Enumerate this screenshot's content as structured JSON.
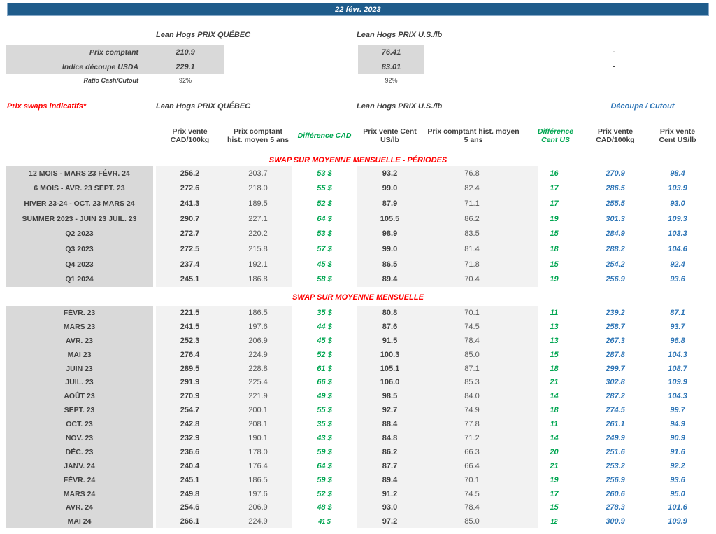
{
  "banner": {
    "date": "22 févr. 2023"
  },
  "summary": {
    "header_quebec": "Lean Hogs PRIX QUÉBEC",
    "header_us": "Lean Hogs PRIX U.S./lb",
    "rows": [
      {
        "label": "Prix comptant",
        "quebec": "210.9",
        "us": "76.41",
        "right": "-"
      },
      {
        "label": "Indice découpe USDA",
        "quebec": "229.1",
        "us": "83.01",
        "right": "-"
      },
      {
        "label": "Ratio Cash/Cutout",
        "quebec": "92%",
        "us": "92%",
        "right": ""
      }
    ]
  },
  "table": {
    "left_title": "Prix swaps indicatifs*",
    "group_quebec": "Lean Hogs PRIX QUÉBEC",
    "group_us": "Lean Hogs PRIX U.S./lb",
    "group_cutout": "Découpe / Cutout",
    "subheaders": [
      "Prix vente CAD/100kg",
      "Prix comptant hist. moyen 5 ans",
      "Différence CAD",
      "Prix vente Cent US/lb",
      "Prix comptant hist. moyen 5 ans",
      "Différence Cent US",
      "Prix vente CAD/100kg",
      "Prix vente Cent US/lb"
    ],
    "sections": [
      {
        "title": "SWAP SUR MOYENNE MENSUELLE - PÉRIODES",
        "rows": [
          [
            "12 MOIS - MARS 23 FÉVR. 24",
            "256.2",
            "203.7",
            "53 $",
            "93.2",
            "76.8",
            "16",
            "270.9",
            "98.4"
          ],
          [
            "6 MOIS - AVR. 23 SEPT. 23",
            "272.6",
            "218.0",
            "55 $",
            "99.0",
            "82.4",
            "17",
            "286.5",
            "103.9"
          ],
          [
            "HIVER 23-24 -  OCT. 23 MARS 24",
            "241.3",
            "189.5",
            "52 $",
            "87.9",
            "71.1",
            "17",
            "255.5",
            "93.0"
          ],
          [
            "SUMMER 2023 - JUIN 23 JUIL. 23",
            "290.7",
            "227.1",
            "64 $",
            "105.5",
            "86.2",
            "19",
            "301.3",
            "109.3"
          ],
          [
            "Q2 2023",
            "272.7",
            "220.2",
            "53 $",
            "98.9",
            "83.5",
            "15",
            "284.9",
            "103.3"
          ],
          [
            "Q3 2023",
            "272.5",
            "215.8",
            "57 $",
            "99.0",
            "81.4",
            "18",
            "288.2",
            "104.6"
          ],
          [
            "Q4 2023",
            "237.4",
            "192.1",
            "45 $",
            "86.5",
            "71.8",
            "15",
            "254.2",
            "92.4"
          ],
          [
            "Q1 2024",
            "245.1",
            "186.8",
            "58 $",
            "89.4",
            "70.4",
            "19",
            "256.9",
            "93.6"
          ]
        ]
      },
      {
        "title": "SWAP SUR MOYENNE MENSUELLE",
        "rows": [
          [
            "FÉVR. 23",
            "221.5",
            "186.5",
            "35 $",
            "80.8",
            "70.1",
            "11",
            "239.2",
            "87.1"
          ],
          [
            "MARS 23",
            "241.5",
            "197.6",
            "44 $",
            "87.6",
            "74.5",
            "13",
            "258.7",
            "93.7"
          ],
          [
            "AVR. 23",
            "252.3",
            "206.9",
            "45 $",
            "91.5",
            "78.4",
            "13",
            "267.3",
            "96.8"
          ],
          [
            "MAI 23",
            "276.4",
            "224.9",
            "52 $",
            "100.3",
            "85.0",
            "15",
            "287.8",
            "104.3"
          ],
          [
            "JUIN 23",
            "289.5",
            "228.8",
            "61 $",
            "105.1",
            "87.1",
            "18",
            "299.7",
            "108.7"
          ],
          [
            "JUIL. 23",
            "291.9",
            "225.4",
            "66 $",
            "106.0",
            "85.3",
            "21",
            "302.8",
            "109.9"
          ],
          [
            "AOÛT 23",
            "270.9",
            "221.9",
            "49 $",
            "98.5",
            "84.0",
            "14",
            "287.2",
            "104.3"
          ],
          [
            "SEPT. 23",
            "254.7",
            "200.1",
            "55 $",
            "92.7",
            "74.9",
            "18",
            "274.5",
            "99.7"
          ],
          [
            "OCT. 23",
            "242.8",
            "208.1",
            "35 $",
            "88.4",
            "77.8",
            "11",
            "261.1",
            "94.9"
          ],
          [
            "NOV. 23",
            "232.9",
            "190.1",
            "43 $",
            "84.8",
            "71.2",
            "14",
            "249.9",
            "90.9"
          ],
          [
            "DÉC. 23",
            "236.6",
            "178.0",
            "59 $",
            "86.2",
            "66.3",
            "20",
            "251.6",
            "91.6"
          ],
          [
            "JANV. 24",
            "240.4",
            "176.4",
            "64 $",
            "87.7",
            "66.4",
            "21",
            "253.2",
            "92.2"
          ],
          [
            "FÉVR. 24",
            "245.1",
            "186.5",
            "59 $",
            "89.4",
            "70.1",
            "19",
            "256.9",
            "93.6"
          ],
          [
            "MARS 24",
            "249.8",
            "197.6",
            "52 $",
            "91.2",
            "74.5",
            "17",
            "260.6",
            "95.0"
          ],
          [
            "AVR. 24",
            "254.6",
            "206.9",
            "48 $",
            "93.0",
            "78.4",
            "15",
            "278.3",
            "101.6"
          ],
          [
            "MAI 24",
            "266.1",
            "224.9",
            "41 $",
            "97.2",
            "85.0",
            "12",
            "300.9",
            "109.9"
          ]
        ]
      }
    ]
  },
  "colors": {
    "banner": "#1f5c8b",
    "green": "#00a651",
    "blue": "#2e75b6",
    "red": "#ff0000",
    "gray_label": "#d9d9d9",
    "gray_light": "#f2f2f2",
    "dark_text": "#404040",
    "mid_text": "#595959"
  }
}
